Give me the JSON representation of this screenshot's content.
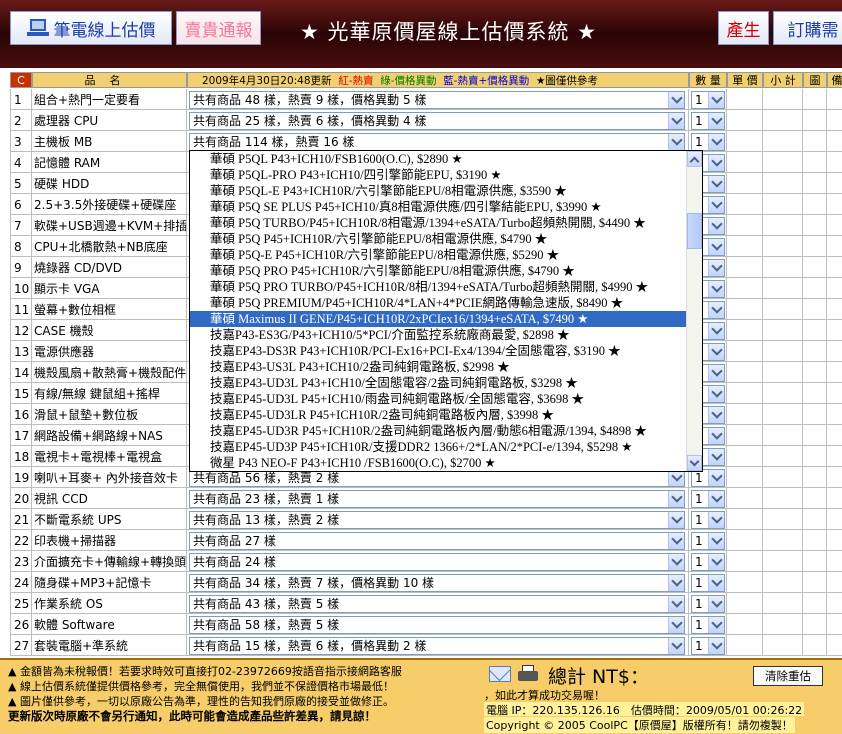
{
  "topbar": {
    "laptop_button": "筆電線上估價",
    "sell_button": "賣貴通報",
    "title": "★ 光華原價屋線上估價系統 ★",
    "produce_button": "產生",
    "order_button": "訂購需"
  },
  "header": {
    "c_label": "C",
    "name_label": "品名",
    "date_text": "2009年4月30日20:48更新",
    "legend_red": "紅-熱賣",
    "legend_green": "綠-價格異動",
    "legend_blue": "藍-熱賣+價格異動",
    "legend_star": "★圖僅供參考",
    "qty_label": "數 量",
    "unit_price_label": "單 價",
    "subtotal_label": "小 計",
    "picture_label": "圖",
    "extra_label": "備"
  },
  "rows": [
    {
      "num": "1",
      "name": "組合+熱門一定要看",
      "select": "共有商品 48 樣，熱賣 9 樣，價格異動 5 樣",
      "qty": "1"
    },
    {
      "num": "2",
      "name": "處理器 CPU",
      "select": "共有商品 25 樣，熱賣 6 樣，價格異動 4 樣",
      "qty": "1"
    },
    {
      "num": "3",
      "name": "主機板 MB",
      "select": "共有商品 114 樣，熱賣 16 樣",
      "qty": "1"
    },
    {
      "num": "4",
      "name": "記憶體 RAM",
      "select": "",
      "qty": ""
    },
    {
      "num": "5",
      "name": "硬碟 HDD",
      "select": "",
      "qty": ""
    },
    {
      "num": "6",
      "name": "2.5+3.5外接硬碟+硬碟座",
      "select": "",
      "qty": ""
    },
    {
      "num": "7",
      "name": "軟碟+USB週邊+KVM+排插",
      "select": "",
      "qty": ""
    },
    {
      "num": "8",
      "name": "CPU+北橋散熱+NB底座",
      "select": "",
      "qty": ""
    },
    {
      "num": "9",
      "name": "燒錄器 CD/DVD",
      "select": "",
      "qty": ""
    },
    {
      "num": "10",
      "name": "顯示卡 VGA",
      "select": "",
      "qty": ""
    },
    {
      "num": "11",
      "name": "螢幕+數位相框",
      "select": "",
      "qty": ""
    },
    {
      "num": "12",
      "name": "CASE 機殼",
      "select": "",
      "qty": ""
    },
    {
      "num": "13",
      "name": "電源供應器",
      "select": "",
      "qty": ""
    },
    {
      "num": "14",
      "name": "機殼風扇+散熱膏+機殼配件",
      "select": "",
      "qty": ""
    },
    {
      "num": "15",
      "name": "有線/無線 鍵鼠組+搖桿",
      "select": "",
      "qty": ""
    },
    {
      "num": "16",
      "name": "滑鼠+鼠墊+數位板",
      "select": "",
      "qty": ""
    },
    {
      "num": "17",
      "name": "網路設備+網路線+NAS",
      "select": "",
      "qty": ""
    },
    {
      "num": "18",
      "name": "電視卡+電視棒+電視盒",
      "select": "",
      "qty": ""
    },
    {
      "num": "19",
      "name": "喇叭+耳麥+ 內外接音效卡",
      "select": "共有商品 56 樣，熱賣 2 樣",
      "qty": "1"
    },
    {
      "num": "20",
      "name": "視訊 CCD",
      "select": "共有商品 23 樣，熱賣 1 樣",
      "qty": "1"
    },
    {
      "num": "21",
      "name": "不斷電系統 UPS",
      "select": "共有商品 13 樣，熱賣 2 樣",
      "qty": "1"
    },
    {
      "num": "22",
      "name": "印表機+掃描器",
      "select": "共有商品 27 樣",
      "qty": "1"
    },
    {
      "num": "23",
      "name": "介面擴充卡+傳輸線+轉換頭",
      "select": "共有商品 24 樣",
      "qty": "1"
    },
    {
      "num": "24",
      "name": "隨身碟+MP3+記憶卡",
      "select": "共有商品 34 樣，熱賣 7 樣，價格異動 10 樣",
      "qty": "1"
    },
    {
      "num": "25",
      "name": "作業系統 OS",
      "select": "共有商品 43 樣，熱賣 5 樣",
      "qty": "1"
    },
    {
      "num": "26",
      "name": "軟體 Software",
      "select": "共有商品 58 樣，熱賣 5 樣",
      "qty": "1"
    },
    {
      "num": "27",
      "name": "套裝電腦+準系統",
      "select": "共有商品 15 樣，熱賣 6 樣，價格異動 2 樣",
      "qty": "1"
    }
  ],
  "dropdown": {
    "options": [
      "華碩 P5QL P43+ICH10/FSB1600(O.C), $2890 ★",
      "華碩 P5QL-PRO P43+ICH10/四引擎節能EPU, $3190 ★",
      "華碩 P5QL-E P43+ICH10R/六引擎節能EPU/8相電源供應, $3590 ★",
      "華碩 P5Q SE PLUS P45+ICH10/真8相電源供應/四引擎結能EPU, $3990 ★",
      "華碩 P5Q TURBO/P45+ICH10R/8相電源/1394+eSATA/Turbo超頻熱開關, $4490 ★",
      "華碩 P5Q P45+ICH10R/六引擎節能EPU/8相電源供應, $4790 ★",
      "華碩 P5Q-E P45+ICH10R/六引擎節能EPU/8相電源供應, $5290 ★",
      "華碩 P5Q PRO P45+ICH10R/六引擎節能EPU/8相電源供應, $4790 ★",
      "華碩 P5Q PRO TURBO/P45+ICH10R/8相/1394+eSATA/Turbo超頻熱開關, $4990 ★",
      "華碩 P5Q PREMIUM/P45+ICH10R/4*LAN+4*PCIE網路傳輸急速版, $8490 ★",
      "華碩 Maximus II GENE/P45+ICH10R/2xPCIex16/1394+eSATA, $7490 ★",
      "技嘉P43-ES3G/P43+ICH10/5*PCI/介面監控系統廠商最愛, $2898 ★",
      "技嘉EP43-DS3R P43+ICH10R/PCI-Ex16+PCI-Ex4/1394/全固態電容, $3190 ★",
      "技嘉EP43-US3L P43+ICH10/2盎司純銅電路板, $2998 ★",
      "技嘉EP43-UD3L P43+ICH10/全固態電容/2盎司純銅電路板, $3298 ★",
      "技嘉EP45-UD3L P45+ICH10/雨盎司純銅電路板/全固態電容, $3698 ★",
      "技嘉EP45-UD3LR P45+ICH10R/2盎司純銅電路板內層, $3998 ★",
      "技嘉EP45-UD3R P45+ICH10R/2盎司純銅電路板內層/動態6相電源/1394, $4898 ★",
      "技嘉EP45-UD3P P45+ICH10R/支援DDR2 1366+/2*LAN/2*PCI-e/1394, $5298 ★",
      "微星 P43 NEO-F P43+ICH10 /FSB1600(O.C), $2700 ★"
    ],
    "selected_index": 10
  },
  "footer": {
    "notes": [
      "▲ 金額皆為未稅報價！若要求時效可直接打02-23972669按語音指示接網路客服",
      "▲ 線上估價系統僅提供價格參考，完全無償使用，我們並不保證價格市場最低！",
      "▲ 圖片僅供參考，一切以原廠公告為準，理性的告知我們原廠的接受並做修正。",
      "更新版次時原廠不會另行通知，此時可能會造成產品些許差異，請見諒！"
    ],
    "total_label": "總計 NT$：",
    "clear_button": "清除重估",
    "promo": "，如此才算成功交易喔！",
    "info": "電腦 IP：220.135.126.16　估價時間：2009/05/01 00:26:22",
    "copyright": "Copyright © 2005 CoolPC【原價屋】版權所有！請勿複製！"
  }
}
